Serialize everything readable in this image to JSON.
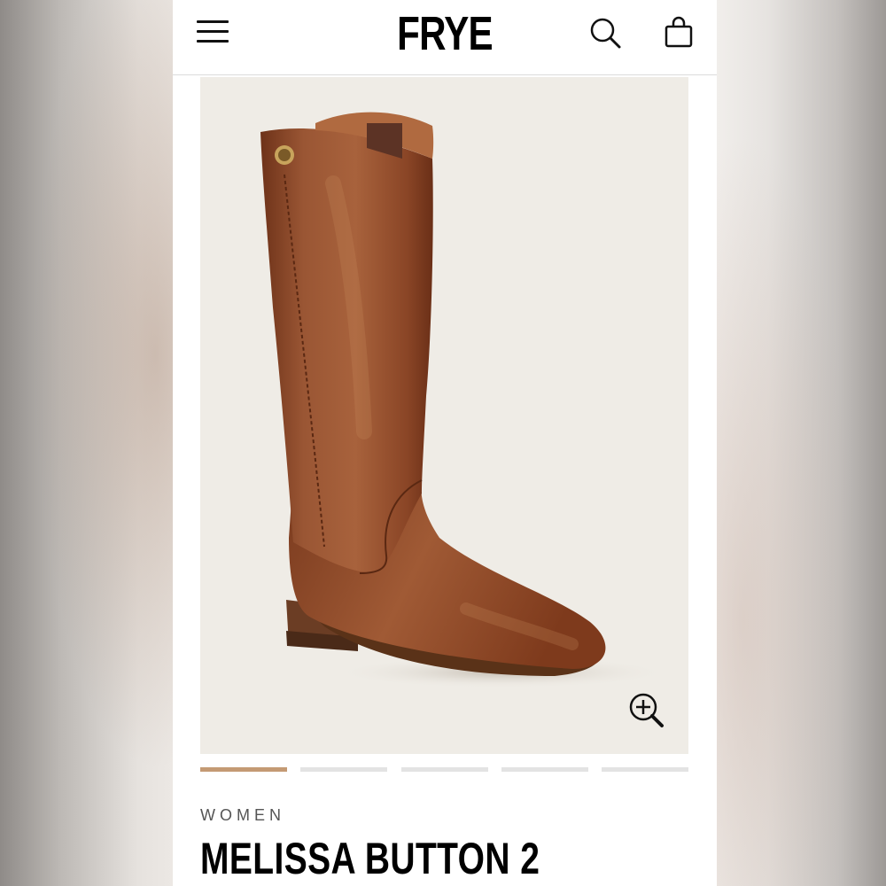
{
  "header": {
    "brand": "FRYE",
    "icons": [
      "menu-icon",
      "search-icon",
      "shopping-bag-icon"
    ]
  },
  "gallery": {
    "image": "brown-leather-tall-riding-boot",
    "zoom_icon": "zoom-in-icon",
    "slide_count": 5,
    "active_slide": 1
  },
  "product": {
    "category": "WOMEN",
    "name": "MELISSA BUTTON 2"
  },
  "colors": {
    "accent": "#c49a74",
    "image_background": "#efece6",
    "boot_leather": "#8e4a2c"
  }
}
